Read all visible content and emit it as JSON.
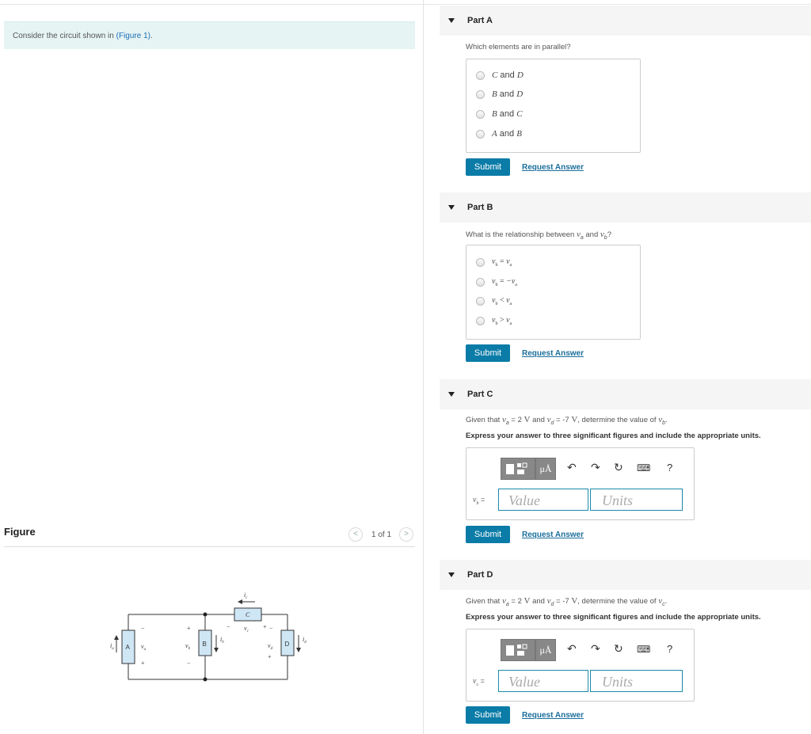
{
  "prompt": {
    "text_before": "Consider the circuit shown in ",
    "link": "(Figure 1)",
    "text_after": "."
  },
  "figure": {
    "label": "Figure",
    "pager": "1 of 1",
    "prev_icon": "<",
    "next_icon": ">"
  },
  "circuit": {
    "A": "A",
    "B": "B",
    "C": "C",
    "D": "D",
    "ia": "i",
    "ia_sub": "a",
    "va": "v",
    "va_sub": "a",
    "vb": "v",
    "vb_sub": "b",
    "ib": "i",
    "ib_sub": "b",
    "ic": "i",
    "ic_sub": "c",
    "vc": "v",
    "vc_sub": "c",
    "vd": "v",
    "vd_sub": "d",
    "id": "i",
    "id_sub": "d",
    "plus": "+",
    "minus": "−"
  },
  "common": {
    "submit": "Submit",
    "request": "Request Answer"
  },
  "partA": {
    "title": "Part A",
    "question": "Which elements are in parallel?",
    "options": [
      {
        "a": "C",
        "and": "and",
        "b": "D"
      },
      {
        "a": "B",
        "and": "and",
        "b": "D"
      },
      {
        "a": "B",
        "and": "and",
        "b": "C"
      },
      {
        "a": "A",
        "and": "and",
        "b": "B"
      }
    ]
  },
  "partB": {
    "title": "Part B",
    "question_before": "What is the relationship between ",
    "question_v1": "v",
    "question_v1_sub": "a",
    "question_and": " and ",
    "question_v2": "v",
    "question_v2_sub": "b",
    "question_after": "?",
    "options": [
      "v_b = v_a",
      "v_b = −v_a",
      "v_b < v_a",
      "v_b > v_a"
    ],
    "option_lhs": "v",
    "option_lhs_sub": "b",
    "option_ops": [
      "=",
      "=",
      "<",
      ">"
    ],
    "option_rhs": [
      "v",
      "−v",
      "v",
      "v"
    ],
    "option_rhs_sub": "a"
  },
  "partC": {
    "title": "Part C",
    "given_1": "Given that ",
    "given_va": "v",
    "given_va_sub": "a",
    "given_eq1": " = 2 ",
    "given_unit1": "V",
    "given_and": " and ",
    "given_vd": "v",
    "given_vd_sub": "d",
    "given_eq2": " = -7 ",
    "given_unit2": "V",
    "given_det": ", determine the value of ",
    "target": "v",
    "target_sub": "b",
    "given_end": ".",
    "instruction": "Express your answer to three significant figures and include the appropriate units.",
    "var": "v",
    "var_sub": "b",
    "var_eq": " =",
    "value_placeholder": "Value",
    "units_placeholder": "Units",
    "mu_label": "μÅ",
    "help_icon": "?"
  },
  "partD": {
    "title": "Part D",
    "given_1": "Given that ",
    "given_va": "v",
    "given_va_sub": "a",
    "given_eq1": " = 2 ",
    "given_unit1": "V",
    "given_and": " and ",
    "given_vd": "v",
    "given_vd_sub": "d",
    "given_eq2": " = -7 ",
    "given_unit2": "V",
    "given_det": ", determine the value of ",
    "target": "v",
    "target_sub": "c",
    "given_end": ".",
    "instruction": "Express your answer to three significant figures and include the appropriate units.",
    "var": "v",
    "var_sub": "c",
    "var_eq": " =",
    "value_placeholder": "Value",
    "units_placeholder": "Units",
    "mu_label": "μÅ",
    "help_icon": "?"
  }
}
